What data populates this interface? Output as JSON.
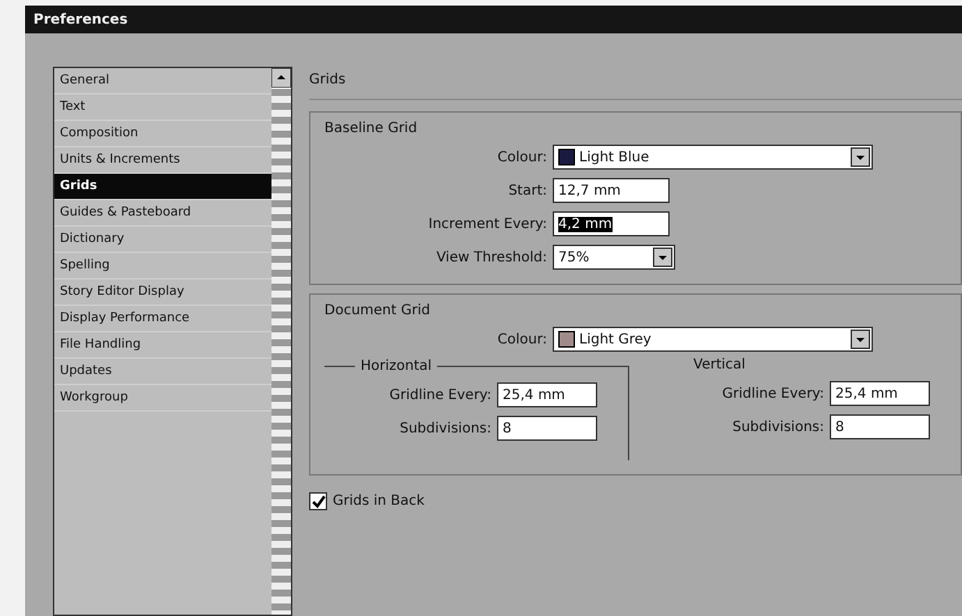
{
  "window": {
    "title": "Preferences"
  },
  "sidebar": {
    "items": [
      {
        "label": "General",
        "selected": false
      },
      {
        "label": "Text",
        "selected": false
      },
      {
        "label": "Composition",
        "selected": false
      },
      {
        "label": "Units & Increments",
        "selected": false
      },
      {
        "label": "Grids",
        "selected": true
      },
      {
        "label": "Guides & Pasteboard",
        "selected": false
      },
      {
        "label": "Dictionary",
        "selected": false
      },
      {
        "label": "Spelling",
        "selected": false
      },
      {
        "label": "Story Editor Display",
        "selected": false
      },
      {
        "label": "Display Performance",
        "selected": false
      },
      {
        "label": "File Handling",
        "selected": false
      },
      {
        "label": "Updates",
        "selected": false
      },
      {
        "label": "Workgroup",
        "selected": false
      }
    ]
  },
  "panel": {
    "title": "Grids",
    "baseline_grid": {
      "title": "Baseline Grid",
      "fields": [
        {
          "kind": "color",
          "label": "Colour:",
          "value": "Light Blue",
          "color": "#1a1a40"
        },
        {
          "kind": "text",
          "label": "Start:",
          "value": "12,7 mm",
          "selected": false
        },
        {
          "kind": "text",
          "label": "Increment Every:",
          "value": "4,2 mm",
          "selected": true
        },
        {
          "kind": "combo",
          "label": "View Threshold:",
          "value": "75%"
        }
      ]
    },
    "document_grid": {
      "title": "Document Grid",
      "colour": {
        "label": "Colour:",
        "value": "Light Grey",
        "color": "#a08a8a"
      },
      "groups": [
        {
          "title": "Horizontal",
          "fields": [
            {
              "label": "Gridline Every:",
              "value": "25,4 mm"
            },
            {
              "label": "Subdivisions:",
              "value": "8"
            }
          ]
        },
        {
          "title": "Vertical",
          "fields": [
            {
              "label": "Gridline Every:",
              "value": "25,4 mm"
            },
            {
              "label": "Subdivisions:",
              "value": "8"
            }
          ]
        }
      ]
    },
    "grids_in_back": {
      "label": "Grids in Back",
      "checked": true
    }
  }
}
